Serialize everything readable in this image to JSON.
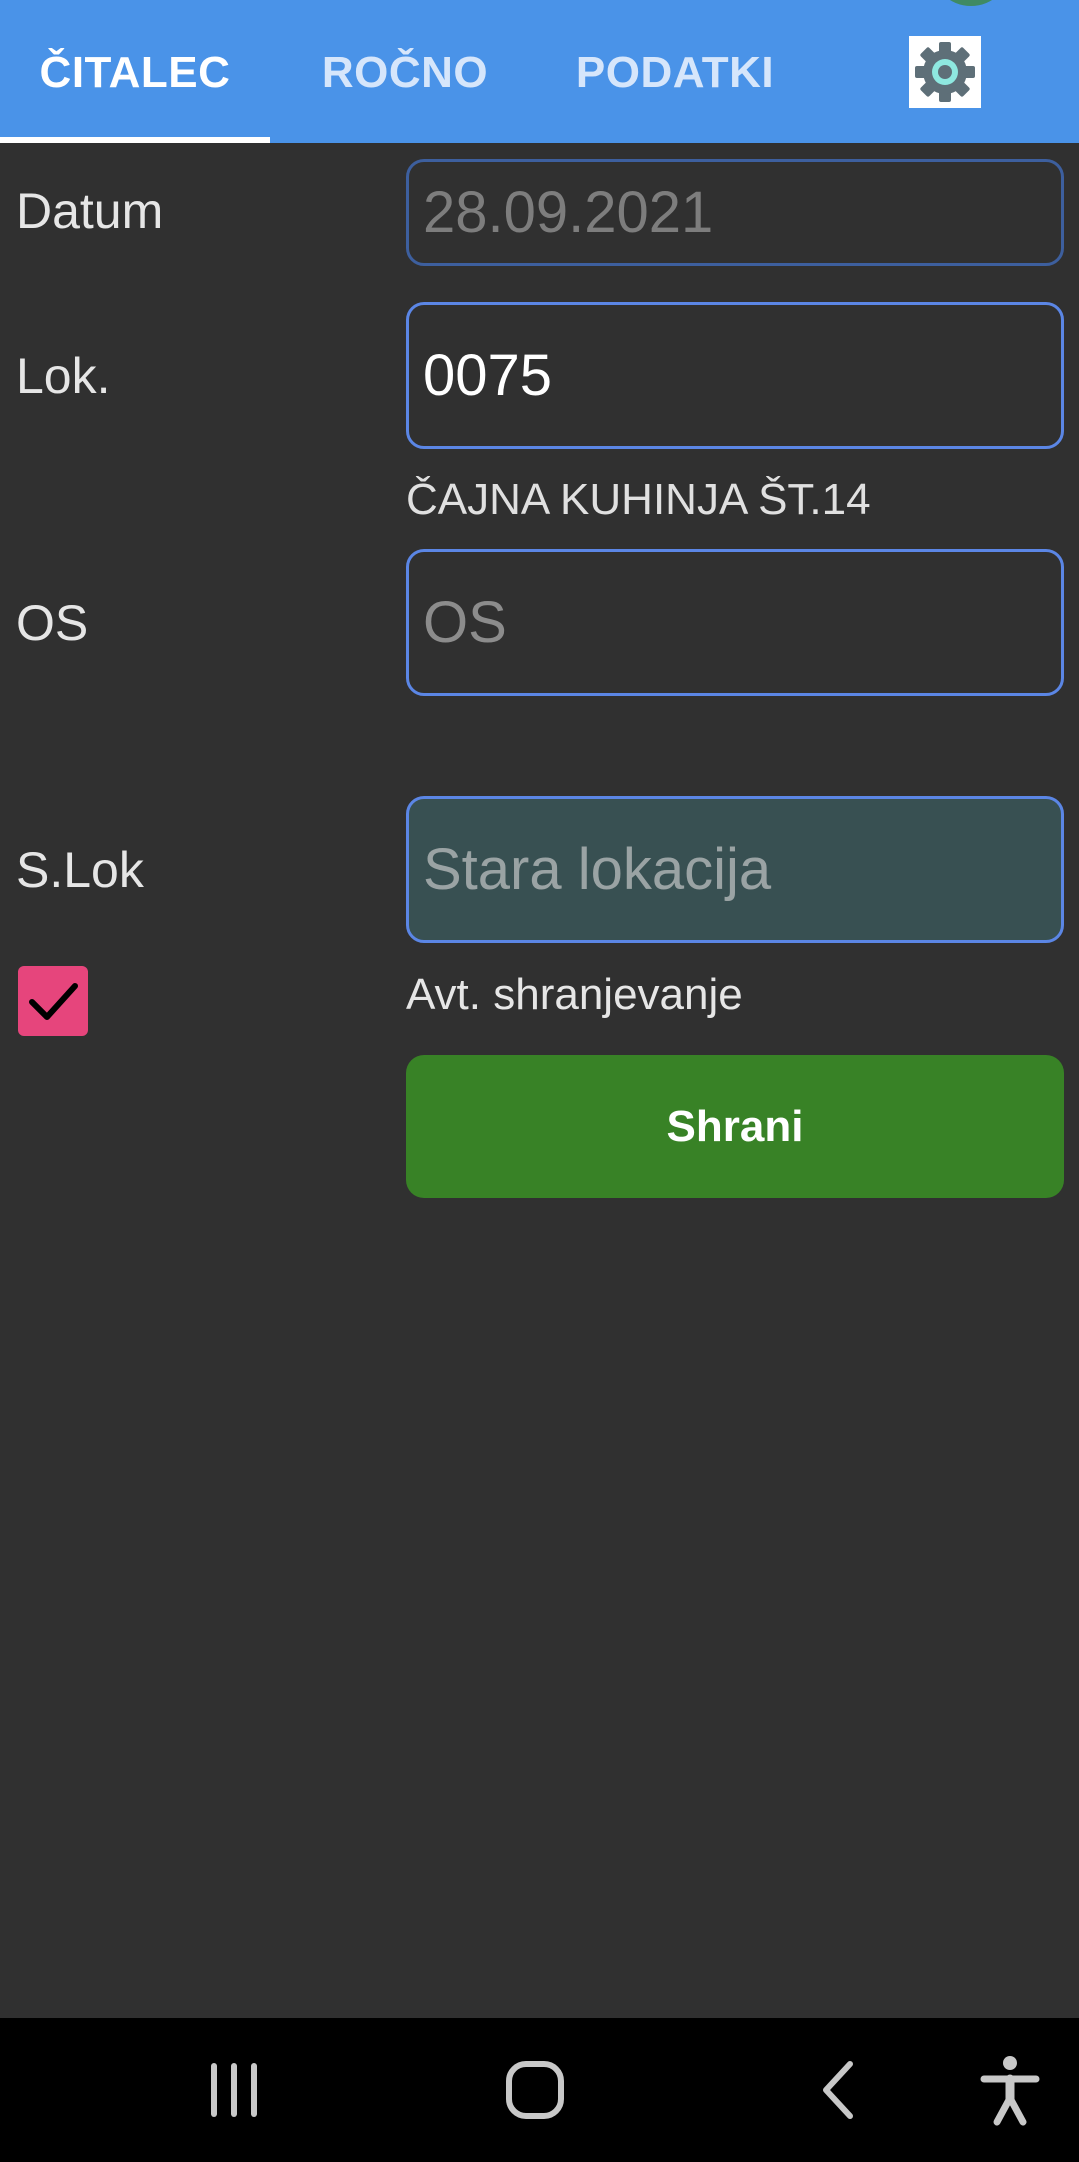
{
  "tabs": [
    {
      "label": "ČITALEC",
      "active": true
    },
    {
      "label": "ROČNO",
      "active": false
    },
    {
      "label": "PODATKI",
      "active": false
    }
  ],
  "settings_icon": "gear-icon",
  "form": {
    "datum": {
      "label": "Datum",
      "value": "28.09.2021",
      "enabled": false
    },
    "lok": {
      "label": "Lok.",
      "value": "0075",
      "description": "ČAJNA KUHINJA ŠT.14"
    },
    "os": {
      "label": "OS",
      "value": "",
      "placeholder": "OS"
    },
    "slok": {
      "label": "S.Lok",
      "value": "",
      "placeholder": "Stara lokacija"
    },
    "auto_save": {
      "label": "Avt. shranjevanje",
      "checked": true
    },
    "save_button": "Shrani"
  },
  "colors": {
    "tab_bar": "#4a93e8",
    "background": "#303030",
    "field_border": "#5b86e5",
    "checkbox": "#e6457c",
    "save_button": "#388226",
    "old_location_field": "#385052"
  },
  "navbar": {
    "recent": "recent-apps-icon",
    "home": "home-icon",
    "back": "back-icon",
    "accessibility": "accessibility-icon"
  }
}
